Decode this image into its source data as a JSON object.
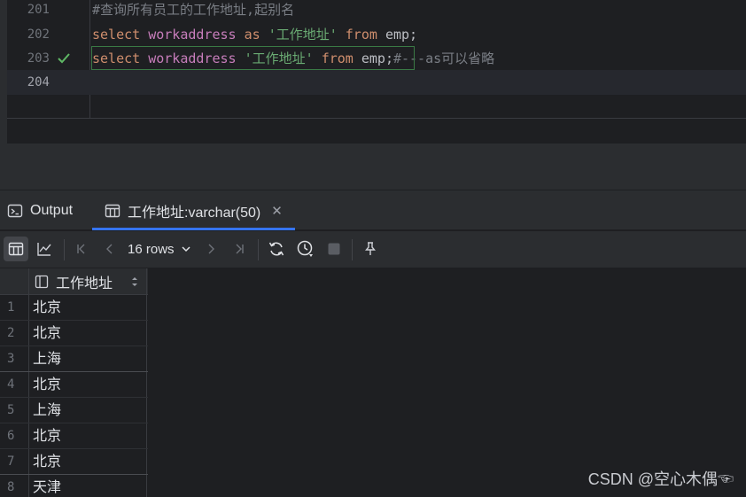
{
  "editor": {
    "lines": [
      {
        "number": "201",
        "text": "#查询所有员工的工作地址,起别名"
      },
      {
        "number": "202",
        "kw1": "select",
        "ident": "workaddress",
        "kw_as": "as",
        "str": "'工作地址'",
        "kw_from": "from",
        "table": "emp",
        "end": ";"
      },
      {
        "number": "203",
        "kw1": "select",
        "ident": "workaddress",
        "str": "'工作地址'",
        "kw_from": "from",
        "table": "emp",
        "end": ";",
        "comment": "#---as可以省略"
      },
      {
        "number": "204"
      }
    ]
  },
  "tabs": {
    "output_label": "Output",
    "result_label": "工作地址:varchar(50)",
    "close_glyph": "✕"
  },
  "toolbar": {
    "rows_label": "16 rows"
  },
  "grid": {
    "column_header": "工作地址",
    "rows": [
      {
        "n": "1",
        "value": "北京"
      },
      {
        "n": "2",
        "value": "北京"
      },
      {
        "n": "3",
        "value": "上海"
      },
      {
        "n": "4",
        "value": "北京"
      },
      {
        "n": "5",
        "value": "上海"
      },
      {
        "n": "6",
        "value": "北京"
      },
      {
        "n": "7",
        "value": "北京"
      },
      {
        "n": "8",
        "value": "天津"
      }
    ]
  },
  "watermark": "CSDN @空心木偶☜",
  "colors": {
    "keyword": "#cf8e6d",
    "identifier": "#c77dbb",
    "string": "#6aab73",
    "accent": "#3574f0",
    "check": "#5fb865"
  }
}
